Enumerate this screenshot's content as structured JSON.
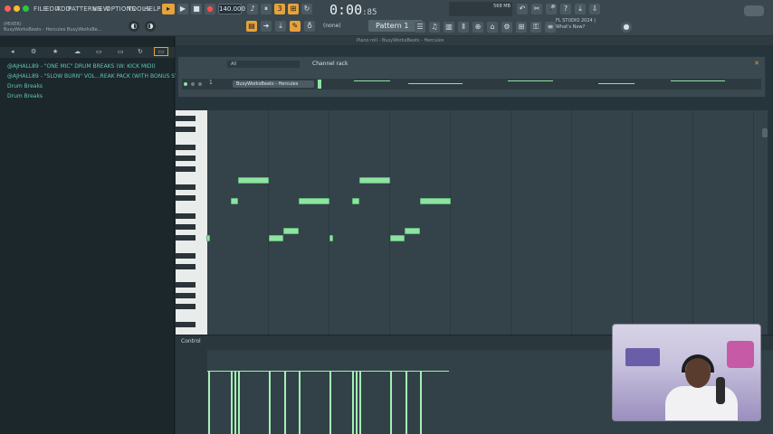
{
  "topbar": {
    "menu": [
      "FILE",
      "EDIT",
      "ADD",
      "PATTERNS",
      "VIEW",
      "OPTIONS",
      "TOOLS",
      "HELP"
    ],
    "bpm": "140.000",
    "time_main": "0:00",
    "time_sub": "85",
    "pattern": "Pattern 1",
    "preset_select": "(none)",
    "cpu_readout": "568 MB",
    "news_line1": "FL STUDIO 2024 |",
    "news_line2": "What's New?",
    "hint_line1": "(MIXER)",
    "hint_line2": "BusyWorksBeats - Hercules BusyWorksBe..."
  },
  "browser": {
    "items": [
      "@AJHALL89 - \"ONE MIC\" DRUM BREAKS (W: KICK MIDI)",
      "@AJHALL89 - \"SLOW BURN\" VOL...REAK PACK (WITH BONUS SYSTEM)",
      "Drum Breaks",
      "Drum Breaks"
    ]
  },
  "main": {
    "subbar": "Piano roll - BusyWorksBeats - Hercules",
    "channel_rack_title": "Channel rack",
    "channel_filter": "All",
    "channel_index": "1",
    "channel_name": "BusyWorksBeats - Hercules",
    "control_label": "Control"
  },
  "colors": {
    "note_fill": "#8fe3a1",
    "accent_orange": "#e6a23c",
    "browser_text": "#5fc7b6"
  }
}
